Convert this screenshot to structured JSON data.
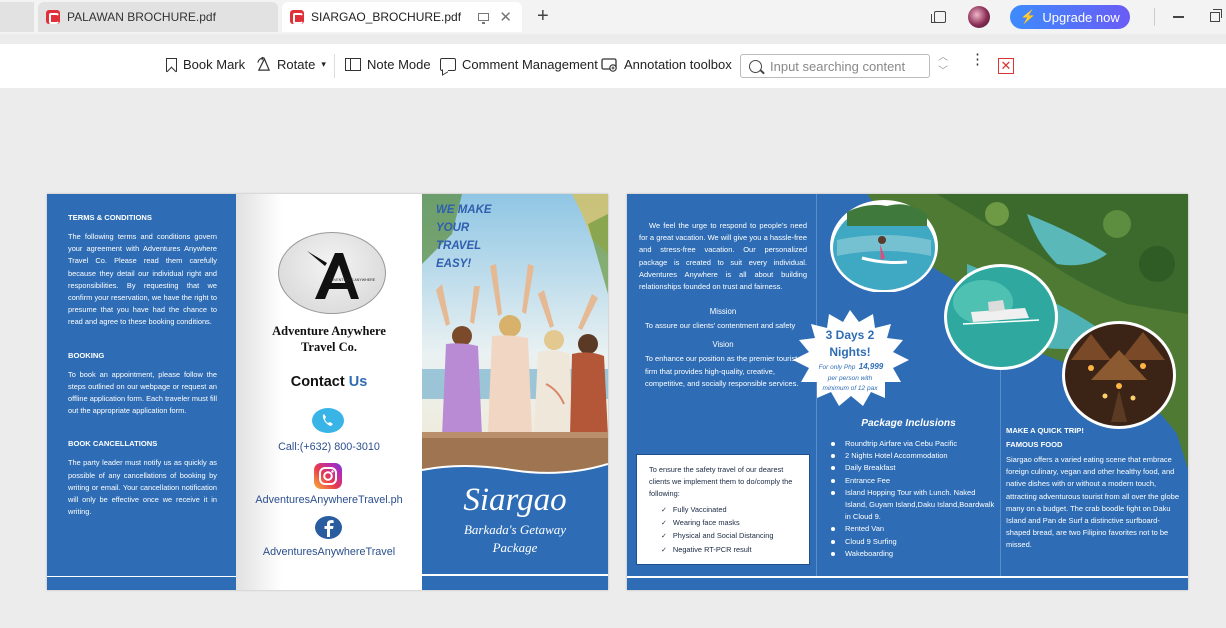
{
  "tabs": [
    {
      "label": "PALAWAN BROCHURE.pdf",
      "active": false
    },
    {
      "label": "SIARGAO_BROCHURE.pdf",
      "active": true
    }
  ],
  "window": {
    "upgrade_label": "Upgrade now",
    "accent": "#4b7bf5"
  },
  "toolbar": {
    "bookmark": "Book Mark",
    "rotate": "Rotate",
    "note_mode": "Note Mode",
    "comment": "Comment Management",
    "annotation": "Annotation toolbox",
    "search_placeholder": "Input searching content"
  },
  "brochure": {
    "brand_blue": "#2e6db5",
    "terms_title": "TERMS & CONDITIONS",
    "terms_text": "The following terms and conditions govern your agreement with Adventures Anywhere Travel Co. Please read them carefully because they detail our individual right and responsibilities. By requesting that we confirm your reservation, we have the right to presume that you have had the chance to read and agree to these booking conditions.",
    "booking_title": "BOOKING",
    "booking_text": "To book an appointment, please follow the steps outlined on our webpage or request an offline application form. Each traveler must fill out the appropriate application form.",
    "cancel_title": "BOOK CANCELLATIONS",
    "cancel_text": "The party leader must notify us as quickly as possible of any cancellations of booking by writing or email. Your cancellation notification will only be effective once we receive it in writing.",
    "company_line1": "Adventure Anywhere",
    "company_line2": "Travel Co.",
    "logo_text": "ADVENTURES ANYWHERE",
    "contact_word": "Contact",
    "contact_us": "Us",
    "phone": "Call:(+632) 800-3010",
    "instagram": "AdventuresAnywhereTravel.ph",
    "facebook": "AdventuresAnywhereTravel",
    "cover_tagline": [
      "WE MAKE",
      "YOUR",
      "TRAVEL",
      "EASY!"
    ],
    "cover_title": "Siargao",
    "cover_subtitle1": "Barkada's Getaway",
    "cover_subtitle2": "Package",
    "intro": "We feel the urge to respond to people's need for a great vacation. We will give you a hassle-free and stress-free vacation. Our personalized package is created to suit every individual. Adventures Anywhere is all about building relationships founded on trust and fairness.",
    "mission_title": "Mission",
    "mission_text": "To assure our clients' contentment and safety",
    "vision_title": "Vision",
    "vision_text": "To enhance our position as the premier tourist firm that provides high-quality, creative, competitive, and socially responsible services.",
    "safety_intro": "To ensure the safety travel of our dearest clients we implement them to do/comply the following:",
    "safety_items": [
      "Fully Vaccinated",
      "Wearing face masks",
      "Physical and Social Distancing",
      "Negative RT-PCR result"
    ],
    "badge_line1": "3 Days 2",
    "badge_line2": "Nights!",
    "badge_price_pre": "For only Php",
    "badge_price": "14,999",
    "badge_line4": "per person with",
    "badge_line5": "minimum of   12 pax",
    "inclusions_title": "Package Inclusions",
    "inclusions": [
      "Roundtrip Airfare via Cebu Pacific",
      "2 Nights Hotel Accommodation",
      "Daily Breakfast",
      "Entrance Fee",
      "Island Hopping Tour with Lunch.   Naked Island, Guyam Island,Daku Island,Boardwalk in Cloud 9.",
      "Rented Van",
      "Cloud 9 Surfing",
      " Wakeboarding"
    ],
    "quick_title": "MAKE A QUICK TRIP!",
    "food_title": "FAMOUS FOOD",
    "food_text": "Siargao offers a varied eating scene that embrace foreign culinary, vegan and other healthy food, and native dishes with or without a modern touch, attracting adventurous tourist from all over the globe many on a budget. The crab boodle fight on Daku Island and Pan de Surf a distinctive surfboard-shaped bread, are two Filipino favorites not to be missed."
  }
}
